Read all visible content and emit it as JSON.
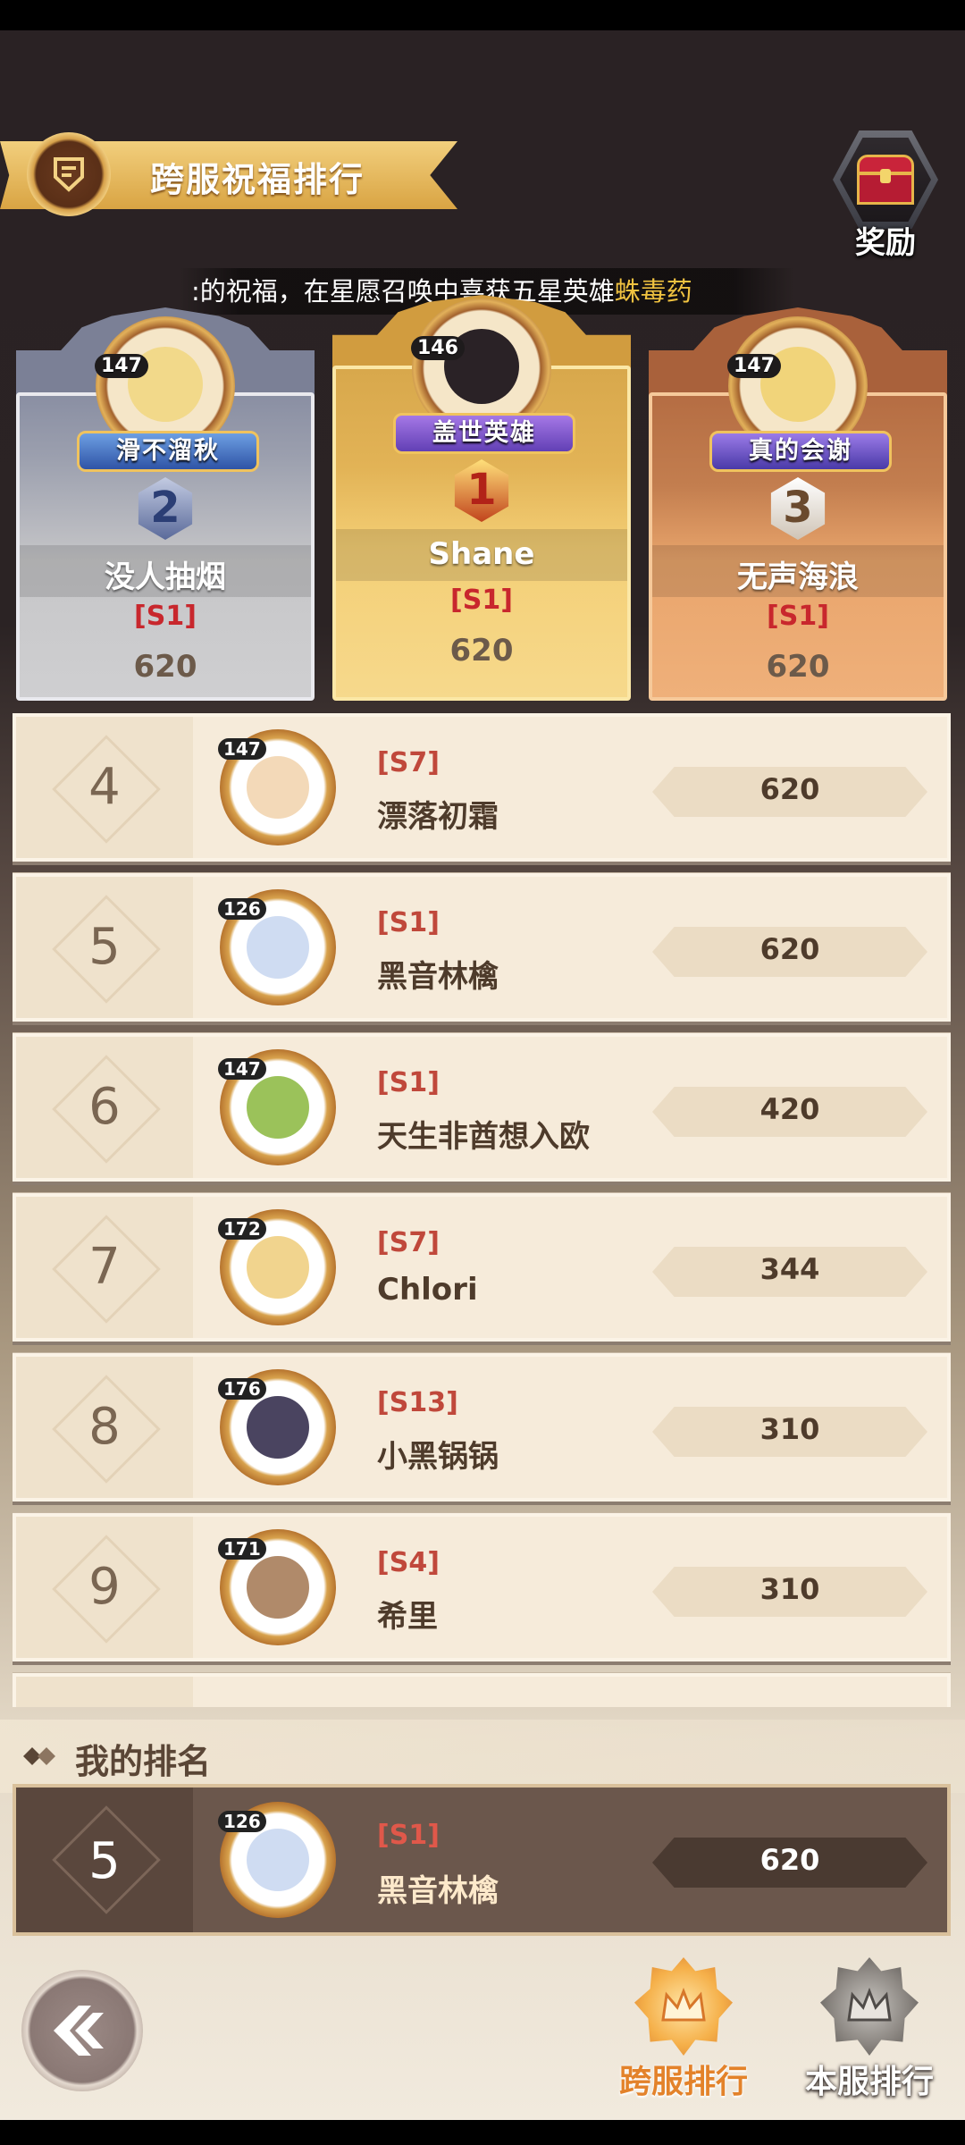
{
  "header": {
    "title": "跨服祝福排行",
    "reward_label": "奖励"
  },
  "ticker": {
    "text": ":的祝福，在星愿召唤中喜获五星英雄",
    "highlight": "蛛毒药"
  },
  "podium": [
    {
      "rank": "2",
      "level": "147",
      "title": "滑不溜秋",
      "name": "没人抽烟",
      "server": "[S1]",
      "score": "620"
    },
    {
      "rank": "1",
      "level": "146",
      "title": "盖世英雄",
      "name": "Shane",
      "server": "[S1]",
      "score": "620"
    },
    {
      "rank": "3",
      "level": "147",
      "title": "真的会谢",
      "name": "无声海浪",
      "server": "[S1]",
      "score": "620"
    }
  ],
  "rows": [
    {
      "rank": "4",
      "level": "147",
      "server": "[S7]",
      "name": "漂落初霜",
      "score": "620",
      "face": "#f3d9b8"
    },
    {
      "rank": "5",
      "level": "126",
      "server": "[S1]",
      "name": "黑音林檎",
      "score": "620",
      "face": "#cfdcf2"
    },
    {
      "rank": "6",
      "level": "147",
      "server": "[S1]",
      "name": "天生非酋想入欧",
      "score": "420",
      "face": "#9bc25a"
    },
    {
      "rank": "7",
      "level": "172",
      "server": "[S7]",
      "name": "Chlori",
      "score": "344",
      "face": "#f1d48e"
    },
    {
      "rank": "8",
      "level": "176",
      "server": "[S13]",
      "name": "小黑锅锅",
      "score": "310",
      "face": "#4a4460"
    },
    {
      "rank": "9",
      "level": "171",
      "server": "[S4]",
      "name": "希里",
      "score": "310",
      "face": "#b08a6a"
    }
  ],
  "my_rank": {
    "header_label": "我的排名",
    "rank": "5",
    "level": "126",
    "server": "[S1]",
    "name": "黑音林檎",
    "score": "620"
  },
  "nav": {
    "cross_server_label": "跨服排行",
    "local_server_label": "本服排行"
  },
  "colors": {
    "gold": "#f0c240",
    "server_red": "#c0483b",
    "active_tab": "#e3822a"
  }
}
